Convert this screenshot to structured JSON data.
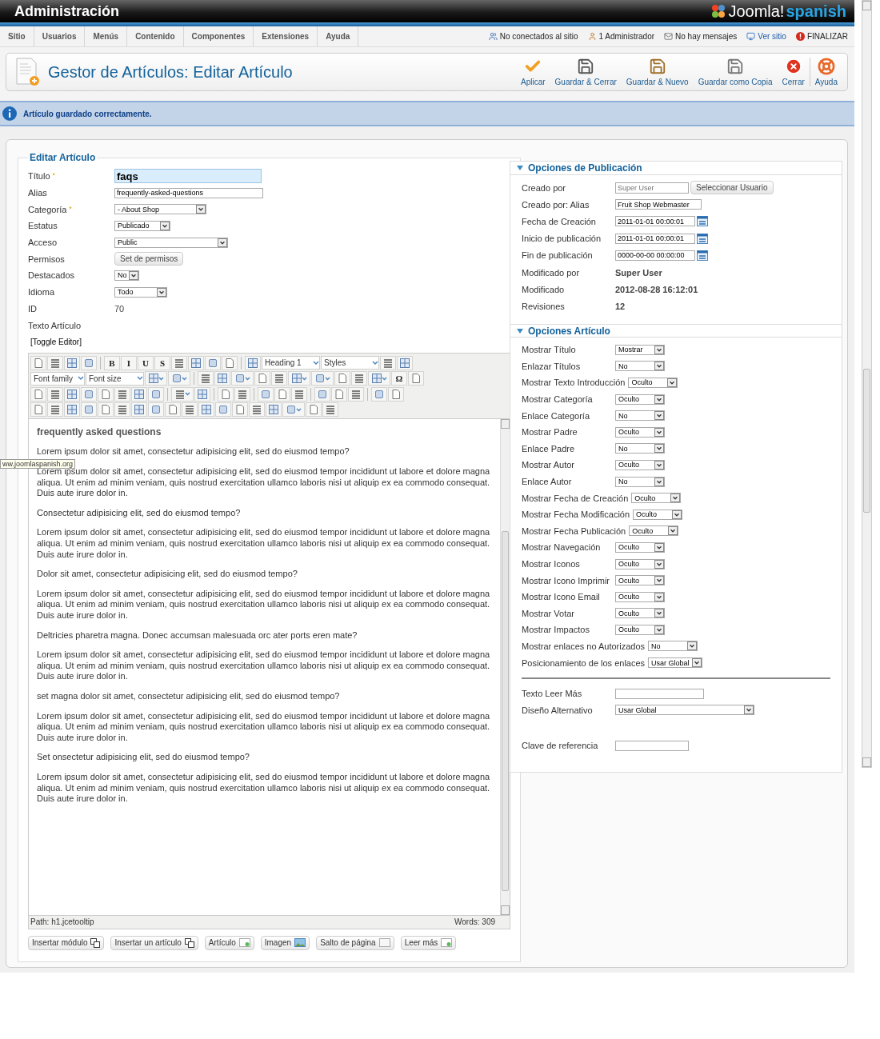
{
  "header": {
    "title": "Administración",
    "logo": {
      "name": "Joomla!",
      "suffix": "spanish"
    }
  },
  "menu": {
    "items": [
      "Sitio",
      "Usuarios",
      "Menús",
      "Contenido",
      "Componentes",
      "Extensiones",
      "Ayuda"
    ],
    "status": [
      {
        "kind": "users",
        "label": "No conectados al sitio"
      },
      {
        "kind": "user",
        "label": "1 Administrador"
      },
      {
        "kind": "mail",
        "label": "No hay mensajes"
      },
      {
        "kind": "link",
        "label": "Ver sitio"
      },
      {
        "kind": "logout",
        "label": "FINALIZAR"
      }
    ]
  },
  "toolbar": {
    "title": "Gestor de Artículos: Editar Artículo",
    "buttons": [
      {
        "kind": "apply",
        "label": "Aplicar"
      },
      {
        "kind": "save",
        "label": "Guardar & Cerrar"
      },
      {
        "kind": "save-new",
        "label": "Guardar & Nuevo"
      },
      {
        "kind": "save-copy",
        "label": "Guardar como Copia"
      },
      {
        "kind": "close",
        "label": "Cerrar"
      },
      {
        "kind": "help",
        "label": "Ayuda"
      }
    ]
  },
  "message": "Artículo guardado correctamente.",
  "tooltip": "ww.joomlaspanish.org",
  "form": {
    "legend": "Editar Artículo",
    "fields": [
      {
        "label": "Título",
        "mark": "*",
        "kind": "input",
        "value": "faqs",
        "focused": true
      },
      {
        "label": "Alias",
        "kind": "input",
        "value": "frequently-asked-questions",
        "focused": false
      },
      {
        "label": "Categoría",
        "mark": "*",
        "kind": "select",
        "value": "- About Shop"
      },
      {
        "label": "Estatus",
        "kind": "select",
        "value": "Publicado"
      },
      {
        "label": "Acceso",
        "kind": "select",
        "value": "Public"
      },
      {
        "label": "Permisos",
        "kind": "button",
        "value": "Set de permisos"
      },
      {
        "label": "Destacados",
        "kind": "select",
        "value": "No"
      },
      {
        "label": "Idioma",
        "kind": "select",
        "value": "Todo"
      },
      {
        "label": "ID",
        "kind": "static",
        "value": "70"
      },
      {
        "label": "Texto Artículo",
        "kind": "label"
      }
    ]
  },
  "editor": {
    "toggle": "[Toggle Editor]",
    "toolbar": [
      [
        {
          "kind": "icon"
        },
        {
          "kind": "icon"
        },
        {
          "kind": "icon"
        },
        {
          "kind": "icon"
        },
        {
          "kind": "sep"
        },
        {
          "kind": "glyph",
          "label": "B"
        },
        {
          "kind": "glyph",
          "label": "I"
        },
        {
          "kind": "glyph",
          "label": "U"
        },
        {
          "kind": "glyph",
          "label": "S"
        },
        {
          "kind": "icon"
        },
        {
          "kind": "icon"
        },
        {
          "kind": "icon"
        },
        {
          "kind": "icon"
        },
        {
          "kind": "sep"
        },
        {
          "kind": "icon"
        },
        {
          "kind": "select",
          "label": "Heading 1"
        },
        {
          "kind": "select",
          "label": "Styles"
        },
        {
          "kind": "icon"
        },
        {
          "kind": "icon"
        }
      ],
      [
        {
          "kind": "select",
          "label": "Font family"
        },
        {
          "kind": "select",
          "label": "Font size"
        },
        {
          "kind": "split"
        },
        {
          "kind": "split"
        },
        {
          "kind": "sep"
        },
        {
          "kind": "icon"
        },
        {
          "kind": "icon"
        },
        {
          "kind": "split"
        },
        {
          "kind": "icon"
        },
        {
          "kind": "icon"
        },
        {
          "kind": "split"
        },
        {
          "kind": "split"
        },
        {
          "kind": "icon"
        },
        {
          "kind": "icon"
        },
        {
          "kind": "split"
        },
        {
          "kind": "glyph",
          "label": "Ω"
        },
        {
          "kind": "icon"
        }
      ],
      [
        {
          "kind": "icon"
        },
        {
          "kind": "icon"
        },
        {
          "kind": "icon"
        },
        {
          "kind": "icon"
        },
        {
          "kind": "icon"
        },
        {
          "kind": "icon"
        },
        {
          "kind": "icon"
        },
        {
          "kind": "icon"
        },
        {
          "kind": "sep"
        },
        {
          "kind": "split"
        },
        {
          "kind": "icon"
        },
        {
          "kind": "sep"
        },
        {
          "kind": "icon"
        },
        {
          "kind": "icon"
        },
        {
          "kind": "sep"
        },
        {
          "kind": "icon"
        },
        {
          "kind": "icon"
        },
        {
          "kind": "icon"
        },
        {
          "kind": "sep"
        },
        {
          "kind": "icon"
        },
        {
          "kind": "icon"
        },
        {
          "kind": "icon"
        },
        {
          "kind": "sep"
        },
        {
          "kind": "icon"
        },
        {
          "kind": "icon"
        }
      ],
      [
        {
          "kind": "icon"
        },
        {
          "kind": "icon"
        },
        {
          "kind": "icon"
        },
        {
          "kind": "icon"
        },
        {
          "kind": "icon"
        },
        {
          "kind": "icon"
        },
        {
          "kind": "icon"
        },
        {
          "kind": "icon"
        },
        {
          "kind": "icon"
        },
        {
          "kind": "icon"
        },
        {
          "kind": "icon"
        },
        {
          "kind": "icon"
        },
        {
          "kind": "icon"
        },
        {
          "kind": "icon"
        },
        {
          "kind": "icon"
        },
        {
          "kind": "split"
        },
        {
          "kind": "icon"
        },
        {
          "kind": "icon"
        }
      ]
    ],
    "content": [
      {
        "kind": "heading",
        "text": "frequently asked questions"
      },
      {
        "kind": "p",
        "text": "Lorem ipsum dolor sit amet, consectetur adipisicing elit, sed do eiusmod tempo?"
      },
      {
        "kind": "p",
        "text": "Lorem ipsum dolor sit amet, consectetur adipisicing elit, sed do eiusmod tempor incididunt ut labore et dolore magna aliqua. Ut enim ad minim veniam, quis nostrud exercitation ullamco laboris nisi ut aliquip ex ea commodo consequat. Duis aute irure dolor in."
      },
      {
        "kind": "p",
        "text": "Consectetur adipisicing elit, sed do eiusmod tempo?"
      },
      {
        "kind": "p",
        "text": "Lorem ipsum dolor sit amet, consectetur adipisicing elit, sed do eiusmod tempor incididunt ut labore et dolore magna aliqua. Ut enim ad minim veniam, quis nostrud exercitation ullamco laboris nisi ut aliquip ex ea commodo consequat. Duis aute irure dolor in."
      },
      {
        "kind": "p",
        "text": "Dolor sit amet, consectetur adipisicing elit, sed do eiusmod tempo?"
      },
      {
        "kind": "p",
        "text": "Lorem ipsum dolor sit amet, consectetur adipisicing elit, sed do eiusmod tempor incididunt ut labore et dolore magna aliqua. Ut enim ad minim veniam, quis nostrud exercitation ullamco laboris nisi ut aliquip ex ea commodo consequat. Duis aute irure dolor in."
      },
      {
        "kind": "p",
        "text": "Deltricies pharetra magna. Donec accumsan malesuada orc ater ports eren mate?"
      },
      {
        "kind": "p",
        "text": "Lorem ipsum dolor sit amet, consectetur adipisicing elit, sed do eiusmod tempor incididunt ut labore et dolore magna aliqua. Ut enim ad minim veniam, quis nostrud exercitation ullamco laboris nisi ut aliquip ex ea commodo consequat. Duis aute irure dolor in."
      },
      {
        "kind": "p",
        "text": "set magna dolor sit amet, consectetur adipisicing elit, sed do eiusmod tempo?"
      },
      {
        "kind": "p",
        "text": "Lorem ipsum dolor sit amet, consectetur adipisicing elit, sed do eiusmod tempor incididunt ut labore et dolore magna aliqua. Ut enim ad minim veniam, quis nostrud exercitation ullamco laboris nisi ut aliquip ex ea commodo consequat. Duis aute irure dolor in."
      },
      {
        "kind": "p",
        "text": "Set onsectetur adipisicing elit, sed do eiusmod tempo?"
      },
      {
        "kind": "p",
        "text": "Lorem ipsum dolor sit amet, consectetur adipisicing elit, sed do eiusmod tempor incididunt ut labore et dolore magna aliqua. Ut enim ad minim veniam, quis nostrud exercitation ullamco laboris nisi ut aliquip ex ea commodo consequat. Duis aute irure dolor in."
      }
    ],
    "path": "Path:  h1.jcetooltip",
    "words": "Words: 309",
    "buttons": [
      {
        "kind": "module",
        "label": "Insertar módulo"
      },
      {
        "kind": "module",
        "label": "Insertar un artículo"
      },
      {
        "kind": "article",
        "label": "Artículo"
      },
      {
        "kind": "image",
        "label": "Imagen"
      },
      {
        "kind": "pagebreak",
        "label": "Salto de página"
      },
      {
        "kind": "article",
        "label": "Leer más"
      }
    ]
  },
  "publishing": {
    "title": "Opciones de Publicación",
    "expanded": true,
    "rows": [
      {
        "label": "Creado por",
        "kind": "user",
        "placeholder": "Super User",
        "button": "Seleccionar Usuario"
      },
      {
        "label": "Creado por: Alias",
        "kind": "input",
        "value": "Fruit Shop Webmaster"
      },
      {
        "label": "Fecha de Creación",
        "kind": "date",
        "value": "2011-01-01 00:00:01"
      },
      {
        "label": "Inicio de publicación",
        "kind": "date",
        "value": "2011-01-01 00:00:01"
      },
      {
        "label": "Fin de publicación",
        "kind": "date",
        "value": "0000-00-00 00:00:00"
      },
      {
        "label": "Modificado por",
        "kind": "static",
        "value": "Super User"
      },
      {
        "label": "Modificado",
        "kind": "static",
        "value": "2012-08-28 16:12:01"
      },
      {
        "label": "Revisiones",
        "kind": "static",
        "value": "12"
      }
    ]
  },
  "options": {
    "title": "Opciones Artículo",
    "expanded": true,
    "rows": [
      {
        "label": "Mostrar Título",
        "kind": "select",
        "value": "Mostrar"
      },
      {
        "label": "Enlazar Títulos",
        "kind": "select",
        "value": "No"
      },
      {
        "label": "Mostrar Texto Introducción",
        "kind": "select",
        "value": "Oculto"
      },
      {
        "label": "Mostrar Categoría",
        "kind": "select",
        "value": "Oculto"
      },
      {
        "label": "Enlace Categoría",
        "kind": "select",
        "value": "No"
      },
      {
        "label": "Mostrar Padre",
        "kind": "select",
        "value": "Oculto"
      },
      {
        "label": "Enlace Padre",
        "kind": "select",
        "value": "No"
      },
      {
        "label": "Mostrar Autor",
        "kind": "select",
        "value": "Oculto"
      },
      {
        "label": "Enlace Autor",
        "kind": "select",
        "value": "No"
      },
      {
        "label": "Mostrar Fecha de Creación",
        "kind": "select",
        "value": "Oculto"
      },
      {
        "label": "Mostrar Fecha Modificación",
        "kind": "select",
        "value": "Oculto"
      },
      {
        "label": "Mostrar Fecha Publicación",
        "kind": "select",
        "value": "Oculto"
      },
      {
        "label": "Mostrar Navegación",
        "kind": "select",
        "value": "Oculto"
      },
      {
        "label": "Mostrar Iconos",
        "kind": "select",
        "value": "Oculto"
      },
      {
        "label": "Mostrar Icono Imprimir",
        "kind": "select",
        "value": "Oculto"
      },
      {
        "label": "Mostrar Icono Email",
        "kind": "select",
        "value": "Oculto"
      },
      {
        "label": "Mostrar Votar",
        "kind": "select",
        "value": "Oculto"
      },
      {
        "label": "Mostrar Impactos",
        "kind": "select",
        "value": "Oculto"
      },
      {
        "label": "Mostrar enlaces no Autorizados",
        "kind": "select",
        "value": "No"
      },
      {
        "label": "Posicionamiento de los enlaces",
        "kind": "select",
        "value": "Usar Global"
      },
      {
        "kind": "divider"
      },
      {
        "label": "Texto Leer Más",
        "kind": "input"
      },
      {
        "label": "Diseño Alternativo",
        "kind": "wide-select",
        "value": "Usar Global"
      },
      {
        "label": "Clave de referencia",
        "kind": "input"
      }
    ]
  }
}
